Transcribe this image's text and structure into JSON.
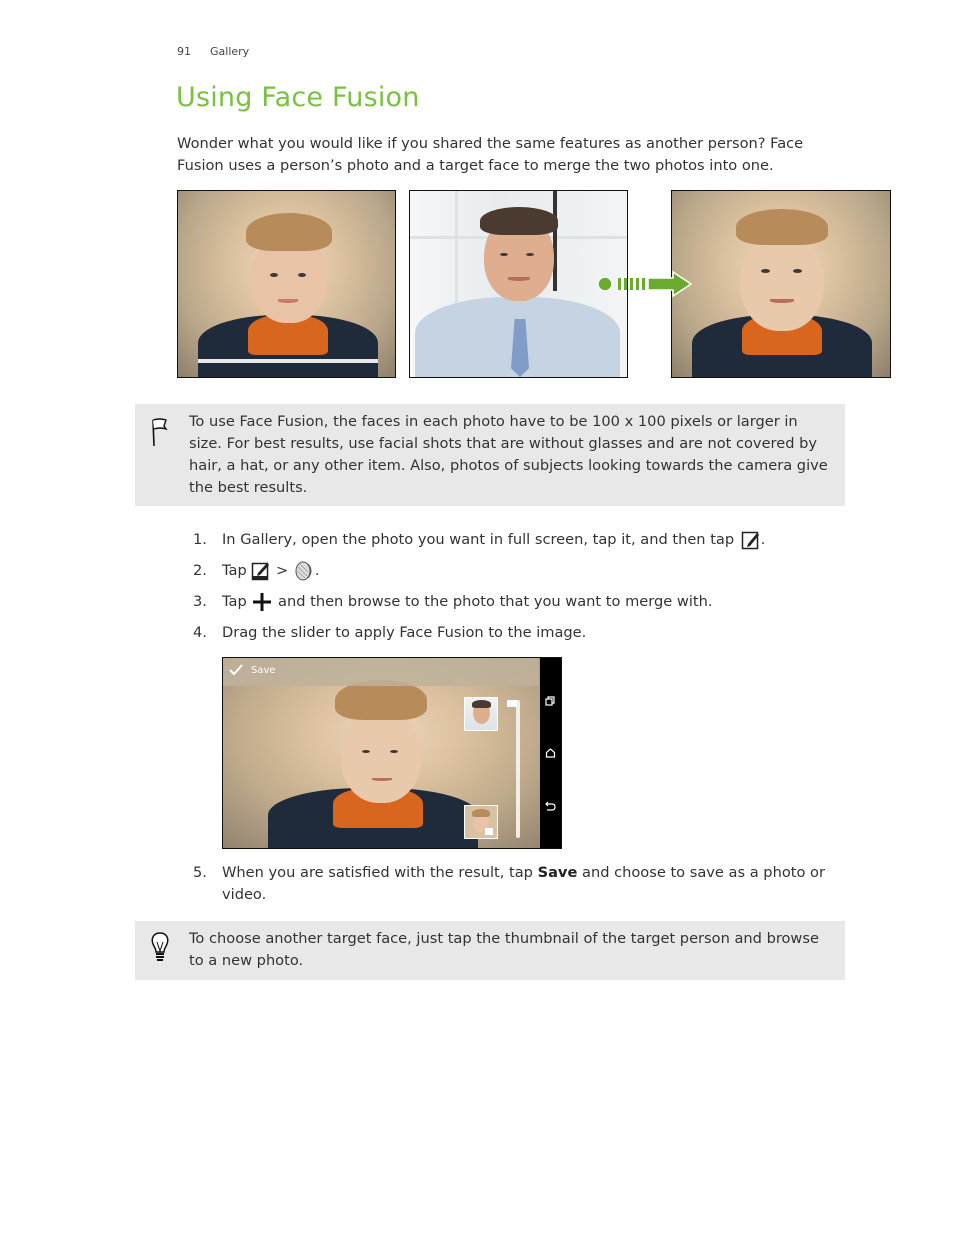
{
  "header": {
    "page_number": "91",
    "section": "Gallery"
  },
  "title": "Using Face Fusion",
  "intro": "Wonder what you would like if you shared the same features as another person? Face Fusion uses a person’s photo and a target face to merge the two photos into one.",
  "figure": {
    "images": [
      {
        "name": "person-photo",
        "description": "Boy in orange and navy jacket"
      },
      {
        "name": "target-face-photo",
        "description": "Man in shirt and blue tie"
      },
      {
        "name": "merged-photo",
        "description": "Fused face result"
      }
    ],
    "arrow_color": "#6aaa2e"
  },
  "note1": "To use Face Fusion, the faces in each photo have to be 100 x 100 pixels or larger in size. For best results, use facial shots that are without glasses and are not covered by hair, a hat, or any other item. Also, photos of subjects looking towards the camera give the best results.",
  "steps": [
    {
      "num": "1.",
      "pre": "In Gallery, open the photo you want in full screen, tap it, and then tap",
      "icon": "edit-icon",
      "post": "."
    },
    {
      "num": "2.",
      "pre": "Tap",
      "icon": "edit-icon",
      "mid": ">",
      "icon2": "face-fusion-icon",
      "post": "."
    },
    {
      "num": "3.",
      "pre": "Tap",
      "icon": "plus-icon",
      "post": "and then browse to the photo that you want to merge with."
    },
    {
      "num": "4.",
      "pre": "Drag the slider to apply Face Fusion to the image.",
      "post": ""
    }
  ],
  "screenshot": {
    "save_label": "Save",
    "slider_value_percent": 100,
    "nav_icons": [
      "recent-apps-icon",
      "home-icon",
      "back-icon"
    ]
  },
  "step5": {
    "num": "5.",
    "pre": "When you are satisfied with the result, tap",
    "bold": "Save",
    "post": "and choose to save as a photo or video."
  },
  "tip": "To choose another target face, just tap the thumbnail of the target person and browse to a new photo.",
  "colors": {
    "title": "#7ac142",
    "note_bg": "#e8e8e8"
  }
}
